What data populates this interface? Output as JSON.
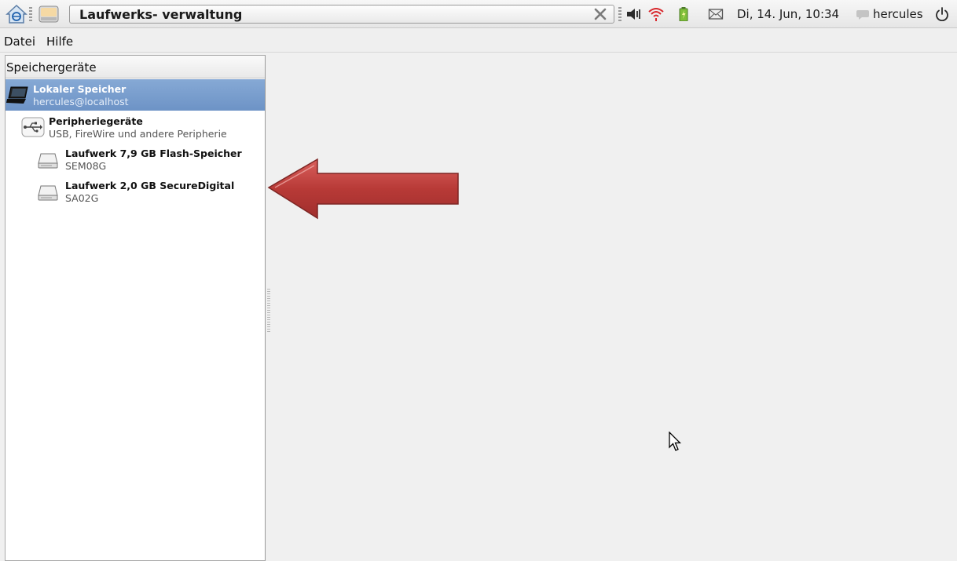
{
  "taskbar": {
    "window_title": "Laufwerks- verwaltung",
    "clock": "Di, 14. Jun, 10:34",
    "username": "hercules",
    "icons": {
      "home": "home-icon",
      "app": "disk-utility-icon",
      "close": "close-icon",
      "volume": "speaker-icon",
      "wifi": "wifi-icon",
      "battery": "battery-icon",
      "mail": "mail-icon",
      "chat": "chat-icon",
      "power": "power-icon"
    }
  },
  "menubar": {
    "items": [
      "Datei",
      "Hilfe"
    ]
  },
  "sidebar": {
    "header": "Speichergeräte",
    "local_storage": {
      "title": "Lokaler Speicher",
      "subtitle": "hercules@localhost"
    },
    "peripherals": {
      "title": "Peripheriegeräte",
      "subtitle": "USB, FireWire und andere Peripherie"
    },
    "drives": [
      {
        "title": "Laufwerk 7,9 GB Flash-Speicher",
        "subtitle": "SEM08G"
      },
      {
        "title": "Laufwerk 2,0 GB SecureDigital",
        "subtitle": "SA02G"
      }
    ]
  },
  "colors": {
    "selection": "#7b9fcf",
    "arrow": "#b83a37"
  }
}
